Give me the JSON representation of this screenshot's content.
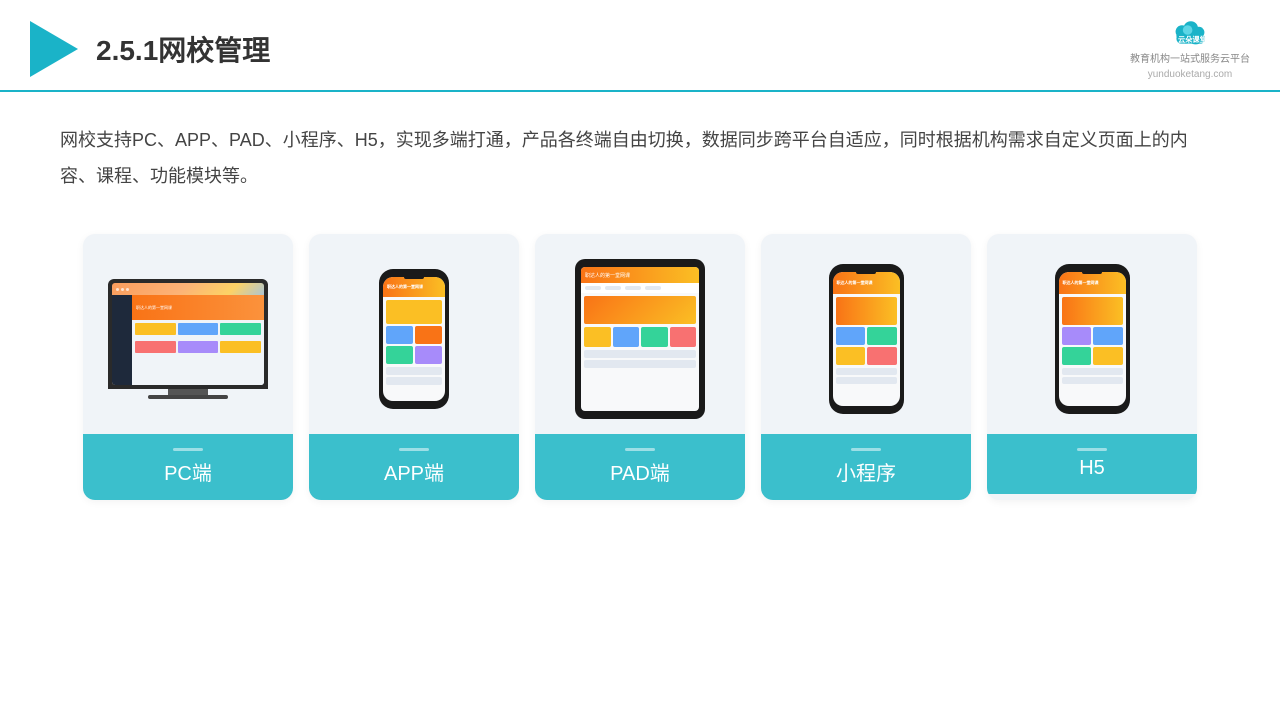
{
  "header": {
    "title": "2.5.1网校管理",
    "brand_name": "云朵课堂",
    "brand_url": "yunduoketang.com",
    "brand_tagline": "教育机构一站\n式服务云平台"
  },
  "description": {
    "text": "网校支持PC、APP、PAD、小程序、H5，实现多端打通，产品各终端自由切换，数据同步跨平台自适应，同时根据机构需求自定义页面上的内容、课程、功能模块等。"
  },
  "cards": [
    {
      "id": "pc",
      "label": "PC端"
    },
    {
      "id": "app",
      "label": "APP端"
    },
    {
      "id": "pad",
      "label": "PAD端"
    },
    {
      "id": "miniprogram",
      "label": "小程序"
    },
    {
      "id": "h5",
      "label": "H5"
    }
  ]
}
